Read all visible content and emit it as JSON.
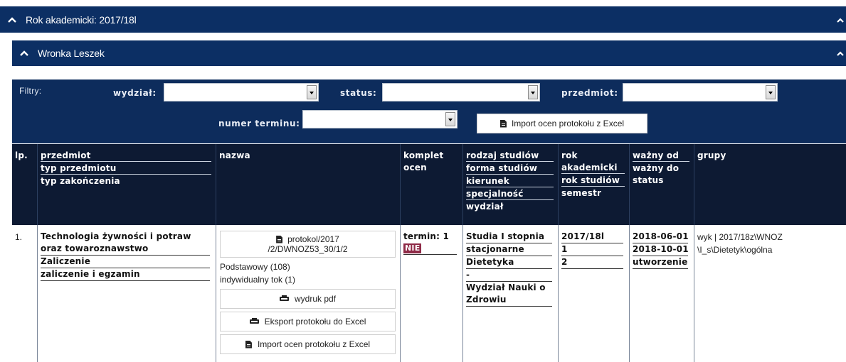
{
  "bar_year": {
    "title": "Rok akademicki: 2017/18l"
  },
  "bar_person": {
    "title": "Wronka Leszek"
  },
  "filters": {
    "label": "Filtry:",
    "wydzial_label": "wydział:",
    "wydzial_value": "",
    "status_label": "status:",
    "status_value": "",
    "przedmiot_label": "przedmiot:",
    "przedmiot_value": "",
    "numer_label": "numer terminu:",
    "numer_value": "",
    "import_label": "Import ocen protokołu z Excel"
  },
  "table_header": {
    "lp": "lp.",
    "przedmiot": "przedmiot",
    "typ_przedmiotu": "typ przedmiotu",
    "typ_zakonczenia": "typ zakończenia",
    "nazwa": "nazwa",
    "komplet_1": "komplet",
    "komplet_2": "ocen",
    "rodzaj": "rodzaj studiów",
    "forma": "forma studiów",
    "kierunek": "kierunek",
    "specjalnosc": "specjalność",
    "wydzial": "wydział",
    "rok_1": "rok",
    "rok_2": "akademicki",
    "rok_studiow": "rok studiów",
    "semestr": "semestr",
    "wazny_od": "ważny od",
    "wazny_do": "ważny do",
    "status": "status",
    "grupy": "grupy"
  },
  "row": {
    "lp": "1.",
    "przedmiot_1": "Technologia żywności i potraw",
    "przedmiot_2": "oraz towaroznawstwo",
    "typ_przedmiotu": "Zaliczenie",
    "typ_zakonczenia": "zaliczenie i egzamin",
    "protokol_line1": "protokol/2017",
    "protokol_line2": "/2/DWNOZ53_30/1/2",
    "podstawowy": "Podstawowy (108)",
    "indywidualny": "indywidualny tok (1)",
    "wydruk_pdf": "wydruk pdf",
    "eksport": "Eksport protokołu do Excel",
    "import": "Import ocen protokołu z Excel",
    "termin": "termin: 1",
    "nie": "NIE",
    "rodzaj": "Studia I stopnia",
    "forma": "stacjonarne",
    "kierunek": "Dietetyka",
    "specjalnosc": "-",
    "wydzial_1": "Wydział Nauki o",
    "wydzial_2": "Zdrowiu",
    "rok_akademicki": "2017/18l",
    "rok_studiow": "1",
    "semestr": "2",
    "wazny_od": "2018-06-01",
    "wazny_do": "2018-10-01",
    "status": "utworzenie",
    "grupy_1": "wyk | 2017/18z\\WNOZ",
    "grupy_2": "\\I_s\\Dietetyk\\ogólna"
  },
  "colors": {
    "bar": "#0c2f64",
    "thead": "#0d1a33",
    "badge": "#8e2a47"
  }
}
